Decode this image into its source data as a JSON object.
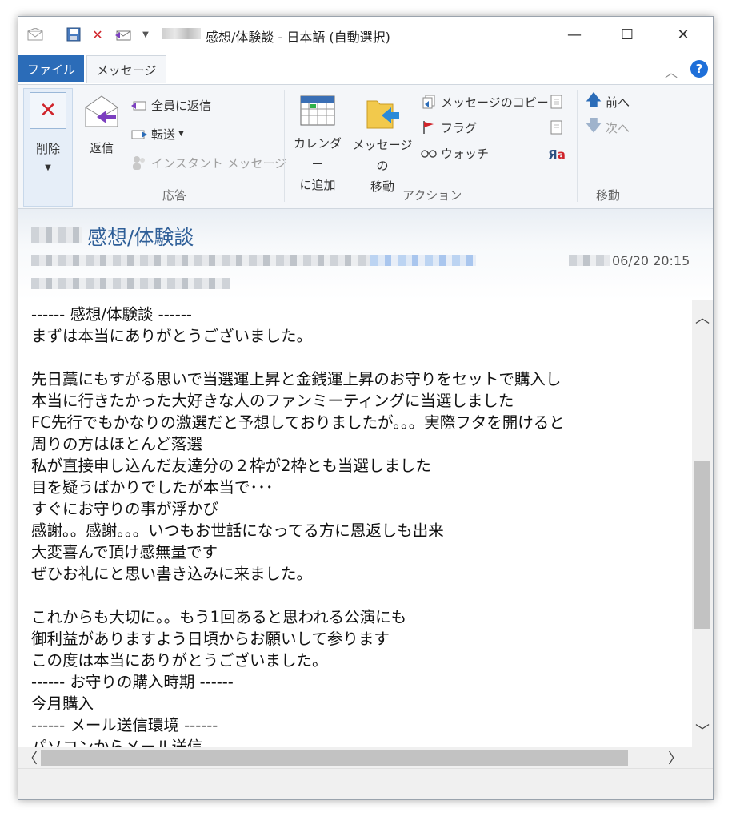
{
  "window": {
    "title": "感想/体験談 - 日本語 (自動選択)"
  },
  "tabs": {
    "file": "ファイル",
    "message": "メッセージ"
  },
  "ribbon": {
    "delete": "削除",
    "reply": "返信",
    "reply_all": "全員に返信",
    "forward": "転送",
    "instant_message": "インスタント メッセージ",
    "group_respond": "応答",
    "add_calendar_line1": "カレンダー",
    "add_calendar_line2": "に追加",
    "move_message_line1": "メッセージの",
    "move_message_line2": "移動",
    "copy_message": "メッセージのコピー",
    "flag": "フラグ",
    "watch": "ウォッチ",
    "group_action": "アクション",
    "prev": "前へ",
    "next": "次へ",
    "group_move": "移動"
  },
  "header": {
    "subject": "感想/体験談",
    "datetime": "06/20 20:15"
  },
  "body": {
    "lines": [
      "------ 感想/体験談 ------",
      "まずは本当にありがとうございました。",
      "",
      "先日藁にもすがる思いで当選運上昇と金銭運上昇のお守りをセットで購入し",
      "本当に行きたかった大好きな人のファンミーティングに当選しました",
      "FC先行でもかなりの激選だと予想しておりましたが。。。実際フタを開けると",
      "周りの方はほとんど落選",
      "私が直接申し込んだ友達分の２枠が2枠とも当選しました",
      "目を疑うばかりでしたが本当で･･･",
      "すぐにお守りの事が浮かび",
      "感謝。。感謝。。。いつもお世話になってる方に恩返しも出来",
      "大変喜んで頂け感無量です",
      "ぜひお礼にと思い書き込みに来ました。",
      "",
      "これからも大切に。。もう1回あると思われる公演にも",
      "御利益がありますよう日頃からお願いして参ります",
      "この度は本当にありがとうございました。",
      "------ お守りの購入時期 ------",
      "今月購入",
      "------ メール送信環境 ------",
      "パソコンからメール送信"
    ]
  },
  "icons": {
    "accent": "#2b6cb8",
    "delete_red": "#d0242b",
    "reply_purple": "#7b3fbf"
  }
}
